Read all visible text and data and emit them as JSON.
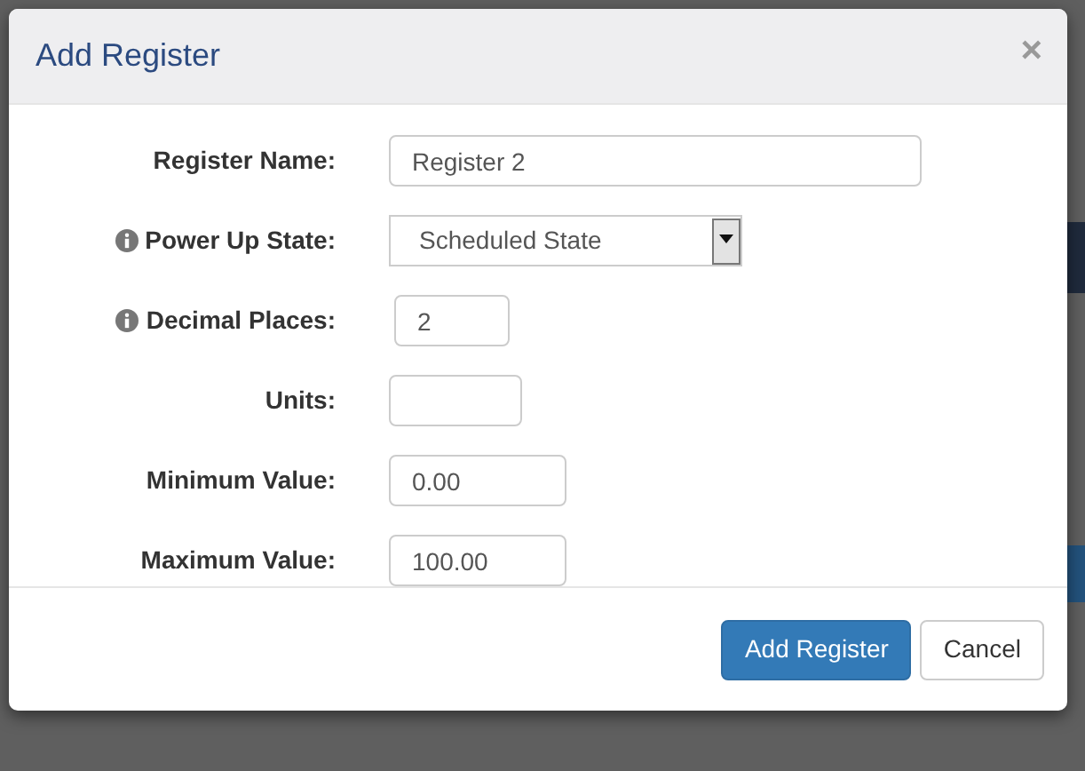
{
  "dialog": {
    "title": "Add Register",
    "close": "×",
    "fields": [
      {
        "label": "Register Name:",
        "kind": "input",
        "info": false,
        "value": "Register 2"
      },
      {
        "label": "Power Up State:",
        "kind": "select",
        "info": true,
        "value": "Scheduled State"
      },
      {
        "label": "Decimal Places:",
        "kind": "input",
        "info": true,
        "value": "2"
      },
      {
        "label": "Units:",
        "kind": "input",
        "info": false
      },
      {
        "label": "Minimum Value:",
        "kind": "input",
        "info": false,
        "value": "0.00"
      },
      {
        "label": "Maximum Value:",
        "kind": "input",
        "info": false,
        "value": "100.00"
      }
    ],
    "buttons": [
      {
        "label": "Add Register",
        "kind": "primary"
      },
      {
        "label": "Cancel",
        "kind": "default"
      }
    ]
  }
}
